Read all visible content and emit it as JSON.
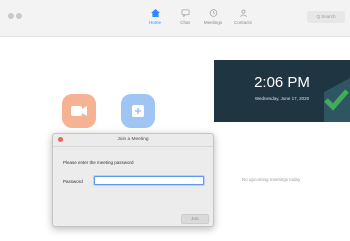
{
  "toolbar": {
    "nav": [
      {
        "label": "Home",
        "icon": "home-icon",
        "active": true
      },
      {
        "label": "Chat",
        "icon": "chat-icon",
        "active": false
      },
      {
        "label": "Meetings",
        "icon": "clock-icon",
        "active": false
      },
      {
        "label": "Contacts",
        "icon": "contacts-icon",
        "active": false
      }
    ],
    "search_label": "Q Search"
  },
  "home": {
    "clock_time": "2:06 PM",
    "clock_date": "Wednesday, June 17, 2020",
    "no_meetings": "No upcoming meetings today"
  },
  "dialog": {
    "title": "Join a Meeting",
    "message": "Please enter the meeting password",
    "password_label": "Password",
    "password_value": "",
    "button_label": "Join"
  },
  "colors": {
    "accent": "#2d8cff",
    "orange_button": "#f6b393",
    "blue_button": "#9fc5f4",
    "clock_card": "#1f3642",
    "check": "#3fae57"
  }
}
